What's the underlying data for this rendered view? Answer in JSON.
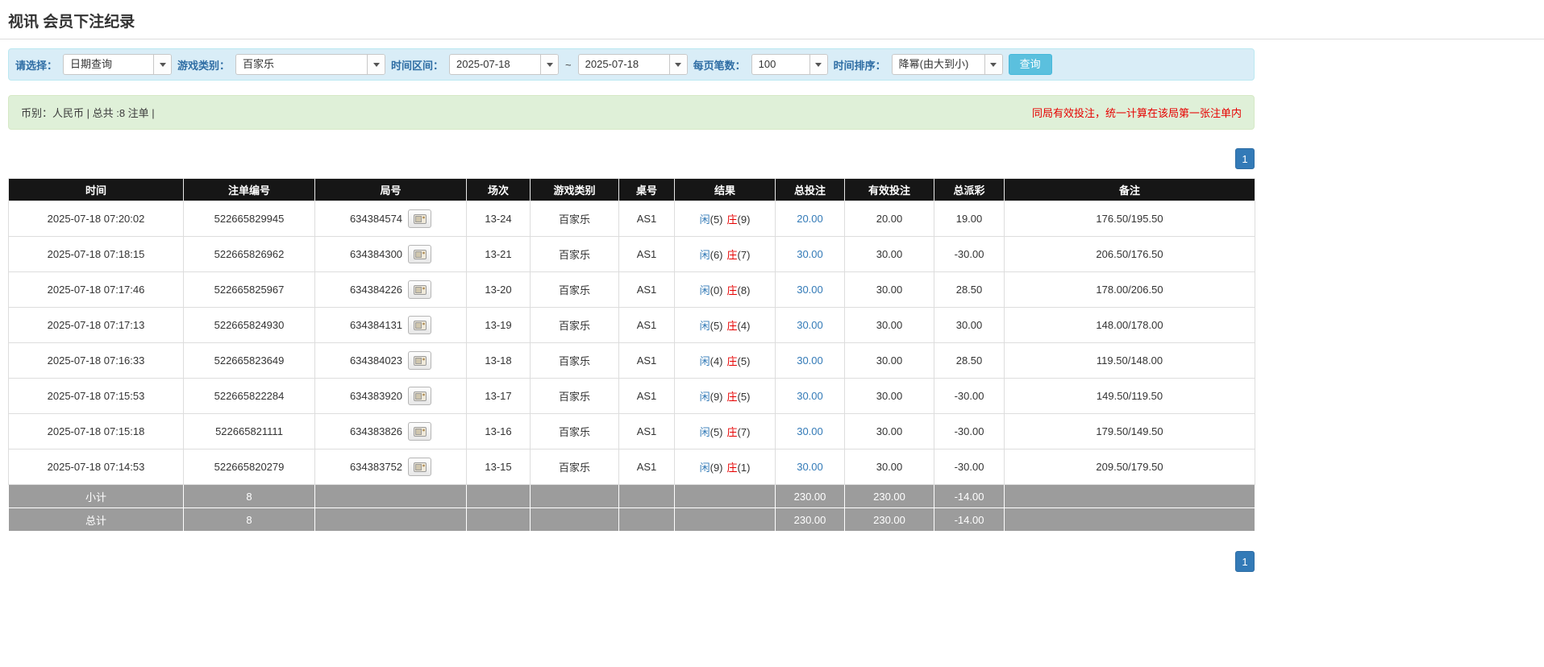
{
  "colors": {
    "accent_blue": "#337ab7",
    "label_blue": "#2e6da4",
    "red": "#e60000",
    "filter_bar_bg": "#d9edf7",
    "notice_bg": "#dff0d8",
    "table_header_bg": "#161616",
    "summary_row_bg": "#9c9c9c",
    "query_button_bg": "#5bc0de"
  },
  "page": {
    "title": "视讯 会员下注纪录"
  },
  "filters": {
    "select_label": "请选择：",
    "select_value": "日期查询",
    "game_label": "游戏类别：",
    "game_value": "百家乐",
    "range_label": "时间区间：",
    "date_from": "2025-07-18",
    "range_separator": "~",
    "date_to": "2025-07-18",
    "page_size_label": "每页笔数：",
    "page_size_value": "100",
    "sort_label": "时间排序：",
    "sort_value": "降幂(由大到小)",
    "query_button": "查询"
  },
  "summary": {
    "left": "币别：人民币 | 总共 :8 注单 |",
    "right": "同局有效投注，统一计算在该局第一张注单内"
  },
  "pagination": {
    "page": "1"
  },
  "records": {
    "headers": [
      "时间",
      "注单编号",
      "局号",
      "场次",
      "游戏类别",
      "桌号",
      "结果",
      "总投注",
      "有效投注",
      "总派彩",
      "备注"
    ],
    "rows": [
      {
        "time": "2025-07-18 07:20:02",
        "bet_no": "522665829945",
        "round_no": "634384574",
        "session": "13-24",
        "game": "百家乐",
        "table_no": "AS1",
        "res_p": "闲",
        "res_p_n": "(5)",
        "res_b": "庄",
        "res_b_n": "(9)",
        "total_bet": "20.00",
        "valid_bet": "20.00",
        "payout": "19.00",
        "note": "176.50/195.50"
      },
      {
        "time": "2025-07-18 07:18:15",
        "bet_no": "522665826962",
        "round_no": "634384300",
        "session": "13-21",
        "game": "百家乐",
        "table_no": "AS1",
        "res_p": "闲",
        "res_p_n": "(6)",
        "res_b": "庄",
        "res_b_n": "(7)",
        "total_bet": "30.00",
        "valid_bet": "30.00",
        "payout": "-30.00",
        "note": "206.50/176.50"
      },
      {
        "time": "2025-07-18 07:17:46",
        "bet_no": "522665825967",
        "round_no": "634384226",
        "session": "13-20",
        "game": "百家乐",
        "table_no": "AS1",
        "res_p": "闲",
        "res_p_n": "(0)",
        "res_b": "庄",
        "res_b_n": "(8)",
        "total_bet": "30.00",
        "valid_bet": "30.00",
        "payout": "28.50",
        "note": "178.00/206.50"
      },
      {
        "time": "2025-07-18 07:17:13",
        "bet_no": "522665824930",
        "round_no": "634384131",
        "session": "13-19",
        "game": "百家乐",
        "table_no": "AS1",
        "res_p": "闲",
        "res_p_n": "(5)",
        "res_b": "庄",
        "res_b_n": "(4)",
        "total_bet": "30.00",
        "valid_bet": "30.00",
        "payout": "30.00",
        "note": "148.00/178.00"
      },
      {
        "time": "2025-07-18 07:16:33",
        "bet_no": "522665823649",
        "round_no": "634384023",
        "session": "13-18",
        "game": "百家乐",
        "table_no": "AS1",
        "res_p": "闲",
        "res_p_n": "(4)",
        "res_b": "庄",
        "res_b_n": "(5)",
        "total_bet": "30.00",
        "valid_bet": "30.00",
        "payout": "28.50",
        "note": "119.50/148.00"
      },
      {
        "time": "2025-07-18 07:15:53",
        "bet_no": "522665822284",
        "round_no": "634383920",
        "session": "13-17",
        "game": "百家乐",
        "table_no": "AS1",
        "res_p": "闲",
        "res_p_n": "(9)",
        "res_b": "庄",
        "res_b_n": "(5)",
        "total_bet": "30.00",
        "valid_bet": "30.00",
        "payout": "-30.00",
        "note": "149.50/119.50"
      },
      {
        "time": "2025-07-18 07:15:18",
        "bet_no": "522665821111",
        "round_no": "634383826",
        "session": "13-16",
        "game": "百家乐",
        "table_no": "AS1",
        "res_p": "闲",
        "res_p_n": "(5)",
        "res_b": "庄",
        "res_b_n": "(7)",
        "total_bet": "30.00",
        "valid_bet": "30.00",
        "payout": "-30.00",
        "note": "179.50/149.50"
      },
      {
        "time": "2025-07-18 07:14:53",
        "bet_no": "522665820279",
        "round_no": "634383752",
        "session": "13-15",
        "game": "百家乐",
        "table_no": "AS1",
        "res_p": "闲",
        "res_p_n": "(9)",
        "res_b": "庄",
        "res_b_n": "(1)",
        "total_bet": "30.00",
        "valid_bet": "30.00",
        "payout": "-30.00",
        "note": "209.50/179.50"
      }
    ],
    "subtotal": {
      "label": "小计",
      "count": "8",
      "total_bet": "230.00",
      "valid_bet": "230.00",
      "payout": "-14.00"
    },
    "total": {
      "label": "总计",
      "count": "8",
      "total_bet": "230.00",
      "valid_bet": "230.00",
      "payout": "-14.00"
    }
  }
}
